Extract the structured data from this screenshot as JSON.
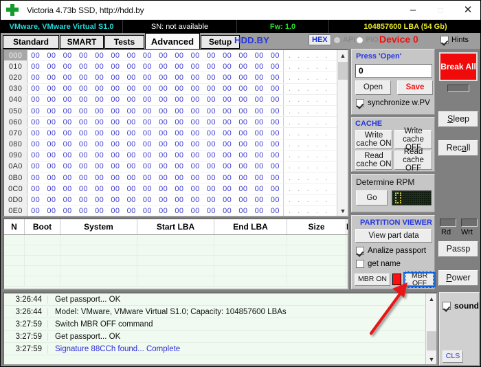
{
  "window": {
    "title": "Victoria 4.73b SSD, http://hdd.by",
    "icon": "green-cross-icon",
    "minimize": "–",
    "maximize": "□",
    "close": "✕"
  },
  "infobar": {
    "model": "VMware, VMware Virtual S1.0",
    "serial": "SN: not available",
    "firmware": "Fw: 1.0",
    "capacity": "104857600 LBA (54 Gb)",
    "colors": {
      "model": "#25d8d8",
      "serial": "#ffffff",
      "firmware": "#29e029",
      "capacity": "#e8e82a"
    }
  },
  "tabs": [
    {
      "label": "Standard",
      "active": false
    },
    {
      "label": "SMART",
      "active": false
    },
    {
      "label": "Tests",
      "active": false
    },
    {
      "label": "Advanced",
      "active": true
    },
    {
      "label": "Setup",
      "active": false
    }
  ],
  "toolbar": {
    "brand": "HDD.BY",
    "hex_badge": "HEX",
    "api_label": "API",
    "pio_label": "PIO",
    "device_label": "Device 0",
    "hints_label": "Hints",
    "hints_checked": true,
    "device_color": "#f01010",
    "brand_color": "#2436e0"
  },
  "hex_view": {
    "offsets": [
      "000",
      "010",
      "020",
      "030",
      "040",
      "050",
      "060",
      "070",
      "080",
      "090",
      "0A0",
      "0B0",
      "0C0",
      "0D0",
      "0E0"
    ],
    "byte_value": "00",
    "bytes_per_row": 16,
    "ascii": ". . . . .",
    "selected_offset": "000",
    "byte_color": "#3a3ad0"
  },
  "partition_table": {
    "columns": [
      "N",
      "Boot",
      "System",
      "Start LBA",
      "End LBA",
      "Size",
      "Name"
    ],
    "rows": []
  },
  "sector_panel": {
    "title": "Press 'Open'",
    "input_value": "0",
    "input_placeholder": "0",
    "open_label": "Open",
    "save_label": "Save",
    "sync_label": "synchronize w.PV",
    "sync_checked": true,
    "save_color": "#f01010"
  },
  "cache_panel": {
    "title": "CACHE",
    "buttons": [
      "Write\ncache ON",
      "Write\ncache OFF",
      "Read\ncache ON",
      "Read\ncache OFF"
    ],
    "write_on_l1": "Write",
    "write_on_l2": "cache ON",
    "write_off_l1": "Write",
    "write_off_l2": "cache OFF",
    "read_on_l1": "Read",
    "read_on_l2": "cache ON",
    "read_off_l1": "Read",
    "read_off_l2": "cache OFF"
  },
  "rpm_panel": {
    "title": "Determine RPM",
    "go_label": "Go",
    "display_value": ""
  },
  "partition_viewer": {
    "title": "PARTITION VIEWER",
    "view_button": "View part data",
    "analize_label": "Analize passport",
    "analize_checked": true,
    "getname_label": "get name",
    "getname_checked": false,
    "mbr_on_label": "MBR ON",
    "mbr_off_label": "MBR OFF",
    "mbr_indicator_color": "#ff1010",
    "mbr_off_focused": true
  },
  "right_rail": {
    "break_all": "Break All",
    "break_all_color": "#f00a0a",
    "sleep": "Sleep",
    "recall": "Recall",
    "rd_label": "Rd",
    "wrt_label": "Wrt",
    "passp": "Passp",
    "power": "Power",
    "sound_label": "sound",
    "sound_checked": true,
    "cls_label": "CLS"
  },
  "log": {
    "entries": [
      {
        "time": "3:26:44",
        "text": "Get passport... OK",
        "highlight": false
      },
      {
        "time": "3:26:44",
        "text": "Model: VMware, VMware Virtual S1.0; Capacity: 104857600 LBAs",
        "highlight": false
      },
      {
        "time": "3:27:59",
        "text": "Switch MBR OFF command",
        "highlight": false
      },
      {
        "time": "3:27:59",
        "text": "Get passport... OK",
        "highlight": false
      },
      {
        "time": "3:27:59",
        "text": "Signature 88CCh found... Complete",
        "highlight": true
      }
    ]
  },
  "annotation": {
    "type": "red-arrow",
    "color": "#e81414",
    "points_to": "MBR OFF"
  }
}
